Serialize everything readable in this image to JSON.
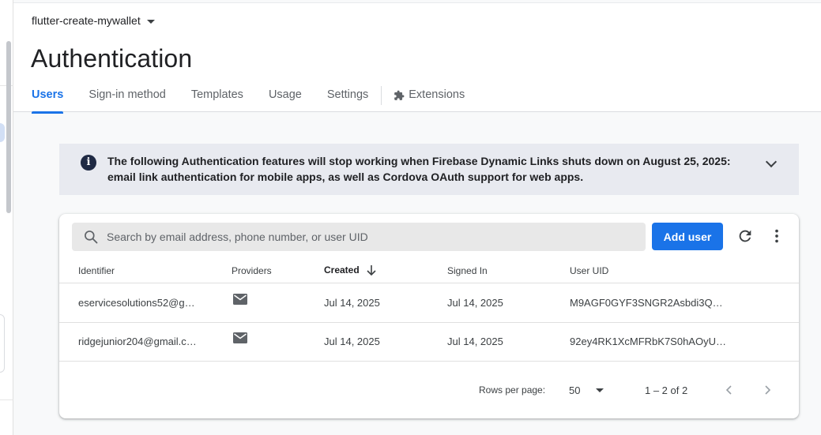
{
  "project": {
    "name": "flutter-create-mywallet"
  },
  "page": {
    "title": "Authentication"
  },
  "tabs": {
    "users": "Users",
    "signin": "Sign-in method",
    "templates": "Templates",
    "usage": "Usage",
    "settings": "Settings",
    "extensions": "Extensions"
  },
  "banner": {
    "text": "The following Authentication features will stop working when Firebase Dynamic Links shuts down on August 25, 2025: email link authentication for mobile apps, as well as Cordova OAuth support for web apps."
  },
  "toolbar": {
    "search_placeholder": "Search by email address, phone number, or user UID",
    "add_user": "Add user"
  },
  "table": {
    "headers": {
      "identifier": "Identifier",
      "providers": "Providers",
      "created": "Created",
      "signed_in": "Signed In",
      "uid": "User UID"
    },
    "rows": [
      {
        "identifier": "eservicesolutions52@g…",
        "provider_icon": "mail-icon",
        "created": "Jul 14, 2025",
        "signed_in": "Jul 14, 2025",
        "uid": "M9AGF0GYF3SNGR2Asbdi3Q…"
      },
      {
        "identifier": "ridgejunior204@gmail.c…",
        "provider_icon": "mail-icon",
        "created": "Jul 14, 2025",
        "signed_in": "Jul 14, 2025",
        "uid": "92ey4RK1XcMFRbK7S0hAOyU…"
      }
    ]
  },
  "pagination": {
    "rows_per_page_label": "Rows per page:",
    "rows_per_page": "50",
    "range": "1 – 2 of 2"
  },
  "colors": {
    "accent": "#1a73e8",
    "banner_bg": "#e8eaf0"
  }
}
